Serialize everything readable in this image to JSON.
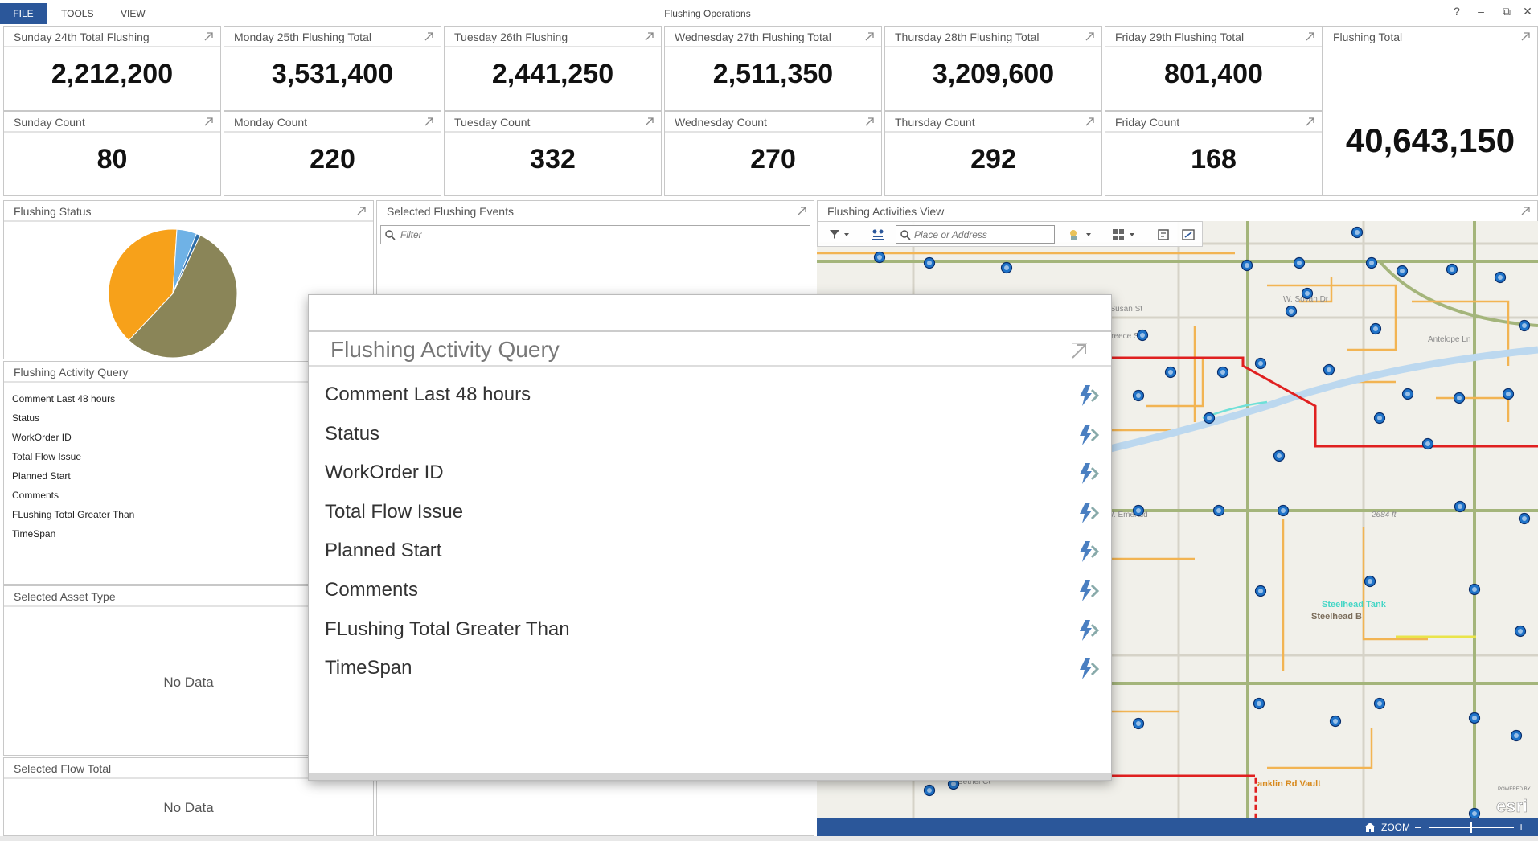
{
  "menu": {
    "file": "FILE",
    "tools": "TOOLS",
    "view": "VIEW"
  },
  "app_title": "Flushing Operations",
  "window_controls": {
    "help": "?",
    "minimize": "–",
    "restore": "⧉",
    "close": "✕"
  },
  "daily_totals": [
    {
      "title": "Sunday 24th Total Flushing",
      "value": "2,212,200"
    },
    {
      "title": "Monday 25th Flushing Total",
      "value": "3,531,400"
    },
    {
      "title": "Tuesday 26th Flushing",
      "value": "2,441,250"
    },
    {
      "title": "Wednesday 27th Flushing Total",
      "value": "2,511,350"
    },
    {
      "title": "Thursday 28th Flushing Total",
      "value": "3,209,600"
    },
    {
      "title": "Friday 29th Flushing Total",
      "value": "801,400"
    }
  ],
  "daily_counts": [
    {
      "title": "Sunday Count",
      "value": "80"
    },
    {
      "title": "Monday Count",
      "value": "220"
    },
    {
      "title": "Tuesday Count",
      "value": "332"
    },
    {
      "title": "Wednesday Count",
      "value": "270"
    },
    {
      "title": "Thursday Count",
      "value": "292"
    },
    {
      "title": "Friday Count",
      "value": "168"
    }
  ],
  "flushing_total": {
    "title": "Flushing Total",
    "value": "40,643,150"
  },
  "flushing_status": {
    "title": "Flushing Status",
    "slices": [
      {
        "value": 55,
        "color": "#8a8558"
      },
      {
        "value": 39,
        "color": "#f7a11a"
      },
      {
        "value": 5,
        "color": "#6fb2e6"
      },
      {
        "value": 1,
        "color": "#2d6da8"
      }
    ]
  },
  "activity_query": {
    "title": "Flushing Activity Query",
    "items": [
      "Comment Last 48 hours",
      "Status",
      "WorkOrder ID",
      "Total Flow Issue",
      "Planned Start",
      "Comments",
      "FLushing Total Greater Than",
      "TimeSpan"
    ]
  },
  "selected_asset_type": {
    "title": "Selected Asset Type",
    "empty": "No Data"
  },
  "selected_flow_total": {
    "title": "Selected Flow Total",
    "empty": "No Data"
  },
  "selected_events": {
    "title": "Selected Flushing Events",
    "filter_placeholder": "Filter"
  },
  "activities_view": {
    "title": "Flushing Activities View",
    "search_placeholder": "Place or Address",
    "zoom_label": "ZOOM",
    "zoom_minus": "–",
    "zoom_plus": "+",
    "esri_label": "esri",
    "powered_by": "POWERED BY",
    "map_labels": {
      "steelhead_tank": "Steelhead Tank",
      "steelhead_b": "Steelhead B",
      "franklin_vault": "anklin Rd Vault",
      "elevation": "2684 ft",
      "w_susan": "W. Susan St",
      "w_sovan": "W. Sovan Dr",
      "w_preece": "W. Preece St",
      "w_emerald": "W. Emerald",
      "antelope": "Antelope Ln",
      "bethel": "Bethel Ct"
    }
  },
  "overlay": {
    "title": "Flushing Activity Query",
    "items": [
      "Comment Last 48 hours",
      "Status",
      "WorkOrder ID",
      "Total Flow Issue",
      "Planned Start",
      "Comments",
      "FLushing Total Greater Than",
      "TimeSpan"
    ]
  }
}
